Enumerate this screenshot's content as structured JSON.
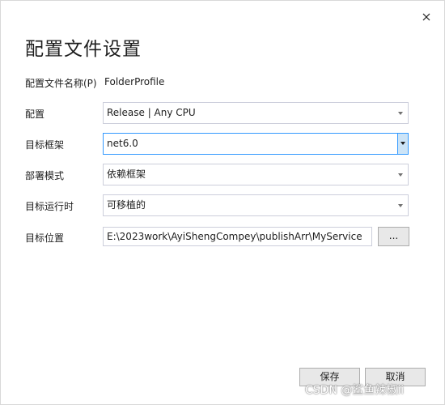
{
  "dialog": {
    "title": "配置文件设置"
  },
  "fields": {
    "profile_name_label": "配置文件名称(P)",
    "profile_name_value": "FolderProfile",
    "configuration_label": "配置",
    "configuration_value": "Release | Any CPU",
    "target_framework_label": "目标框架",
    "target_framework_value": "net6.0",
    "deployment_mode_label": "部署模式",
    "deployment_mode_value": "依赖框架",
    "target_runtime_label": "目标运行时",
    "target_runtime_value": "可移植的",
    "target_location_label": "目标位置",
    "target_location_value": "E:\\2023work\\AyiShengCompey\\publishArr\\MyService",
    "browse_label": "..."
  },
  "footer": {
    "save_label": "保存",
    "cancel_label": "取消"
  },
  "watermark": {
    "text": "CSDN @鲨鱼辣椒ii"
  }
}
